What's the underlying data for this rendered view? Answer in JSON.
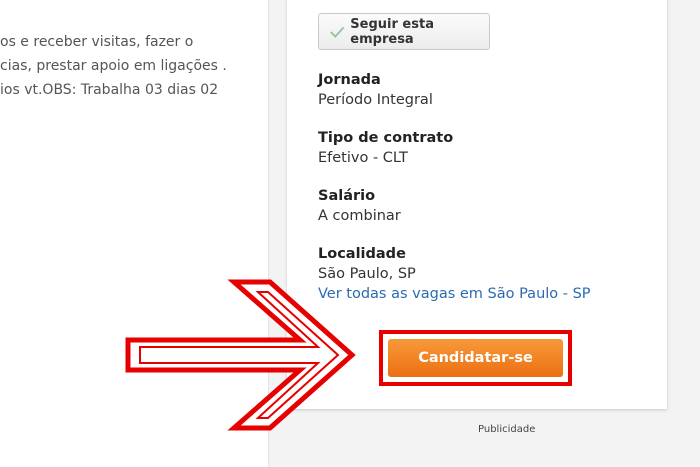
{
  "description": {
    "lines": [
      "os e receber visitas, fazer o",
      "cias, prestar apoio em ligações .",
      "ios vt.OBS: Trabalha 03 dias 02"
    ]
  },
  "sidebar": {
    "follow_label": "Seguir esta empresa",
    "follow_icon": "check-icon",
    "jornada_label": "Jornada",
    "jornada_value": "Período Integral",
    "contrato_label": "Tipo de contrato",
    "contrato_value": "Efetivo - CLT",
    "salario_label": "Salário",
    "salario_value": "A combinar",
    "localidade_label": "Localidade",
    "localidade_value": "São Paulo, SP",
    "localidade_link": "Ver todas as vagas em São Paulo - SP",
    "apply_label": "Candidatar-se"
  },
  "ad_label": "Publicidade",
  "colors": {
    "apply_button": "#ec6f12",
    "highlight": "#e60000",
    "link": "#2a6ab3"
  }
}
